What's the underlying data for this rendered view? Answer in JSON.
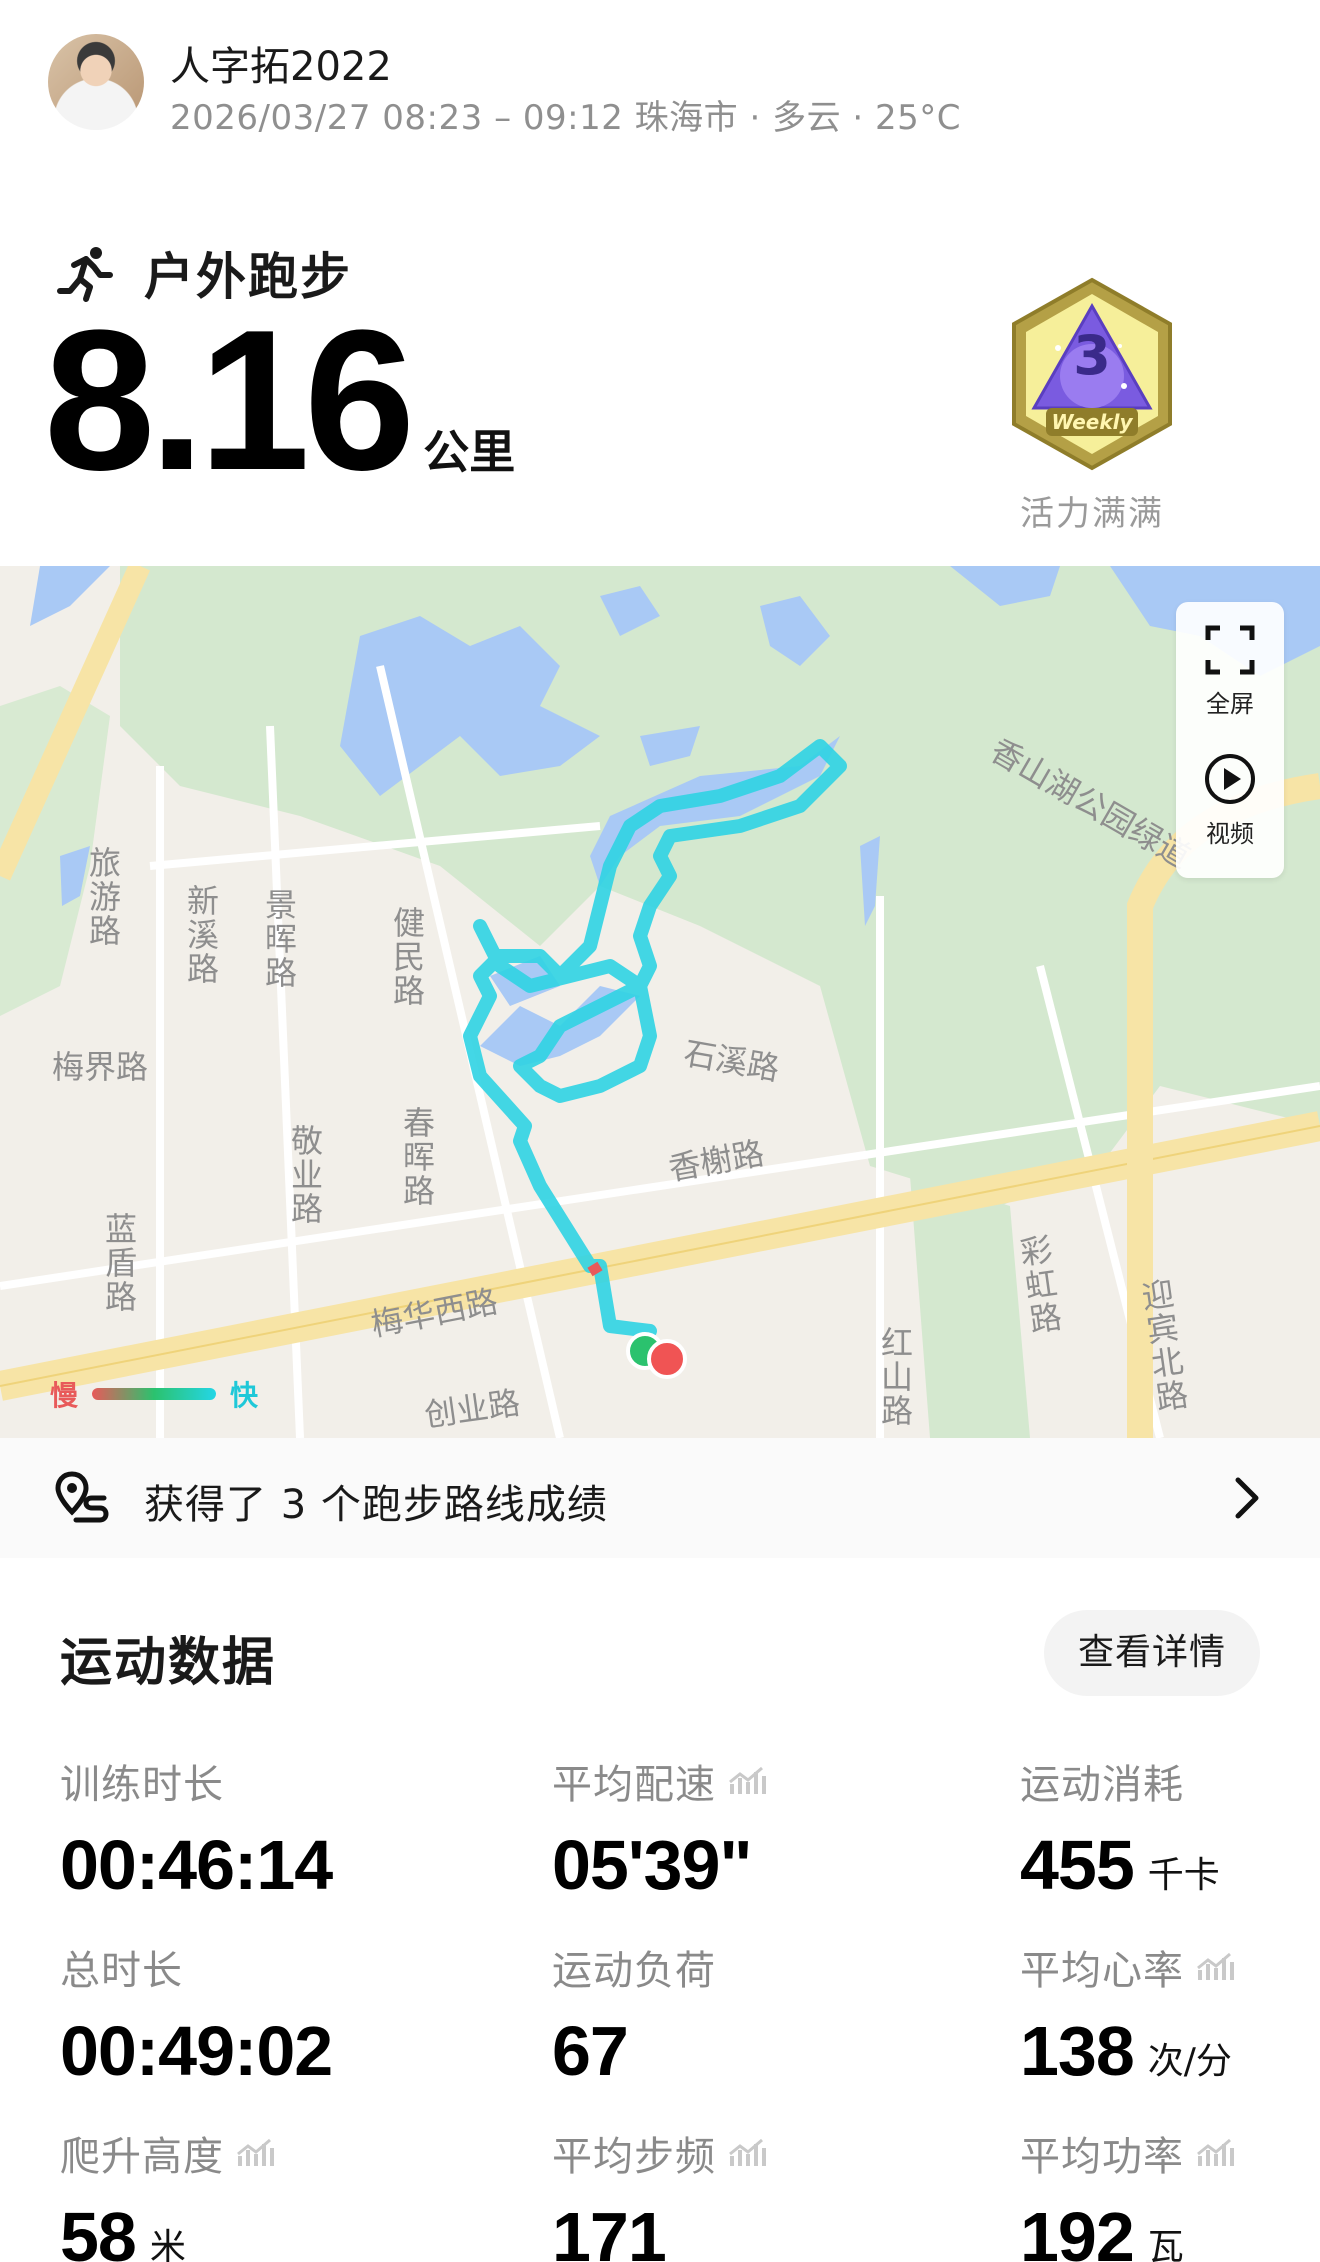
{
  "user": {
    "name": "人字拓2022",
    "meta": "2026/03/27 08:23 – 09:12 珠海市 · 多云 · 25°C"
  },
  "workout": {
    "sport": "户外跑步",
    "distance": "8.16",
    "distance_unit": "公里"
  },
  "medal": {
    "label": "活力满满",
    "badge_text": "Weekly",
    "badge_number": "3"
  },
  "map": {
    "road_labels": [
      "旅游路",
      "新溪路",
      "景晖路",
      "健民路",
      "梅界路",
      "敬业路",
      "春晖路",
      "蓝盾路",
      "石溪路",
      "香榭路",
      "梅华西路",
      "创业路",
      "彩虹路",
      "红山路",
      "迎宾北路",
      "香山湖公园绿道"
    ],
    "controls": {
      "fullscreen": "全屏",
      "video": "视频"
    },
    "legend": {
      "slow": "慢",
      "fast": "快"
    }
  },
  "achievement": {
    "text": "获得了 3 个跑步路线成绩"
  },
  "stats": {
    "title": "运动数据",
    "details_button": "查看详情",
    "items": [
      {
        "label": "训练时长",
        "value": "00:46:14",
        "unit": ""
      },
      {
        "label": "平均配速",
        "value": "05'39\"",
        "unit": ""
      },
      {
        "label": "运动消耗",
        "value": "455",
        "unit": "千卡"
      },
      {
        "label": "总时长",
        "value": "00:49:02",
        "unit": ""
      },
      {
        "label": "运动负荷",
        "value": "67",
        "unit": ""
      },
      {
        "label": "平均心率",
        "value": "138",
        "unit": "次/分"
      },
      {
        "label": "爬升高度",
        "value": "58",
        "unit": "米"
      },
      {
        "label": "平均步频",
        "value": "171",
        "unit": ""
      },
      {
        "label": "平均功率",
        "value": "192",
        "unit": "瓦"
      }
    ]
  },
  "colors": {
    "route": "#2fd3e3",
    "water": "#a9c9f5",
    "park": "#d4e8cf",
    "main_road": "#f7e4a6",
    "slow": "#e85a5a",
    "fast": "#1fc8d8"
  }
}
